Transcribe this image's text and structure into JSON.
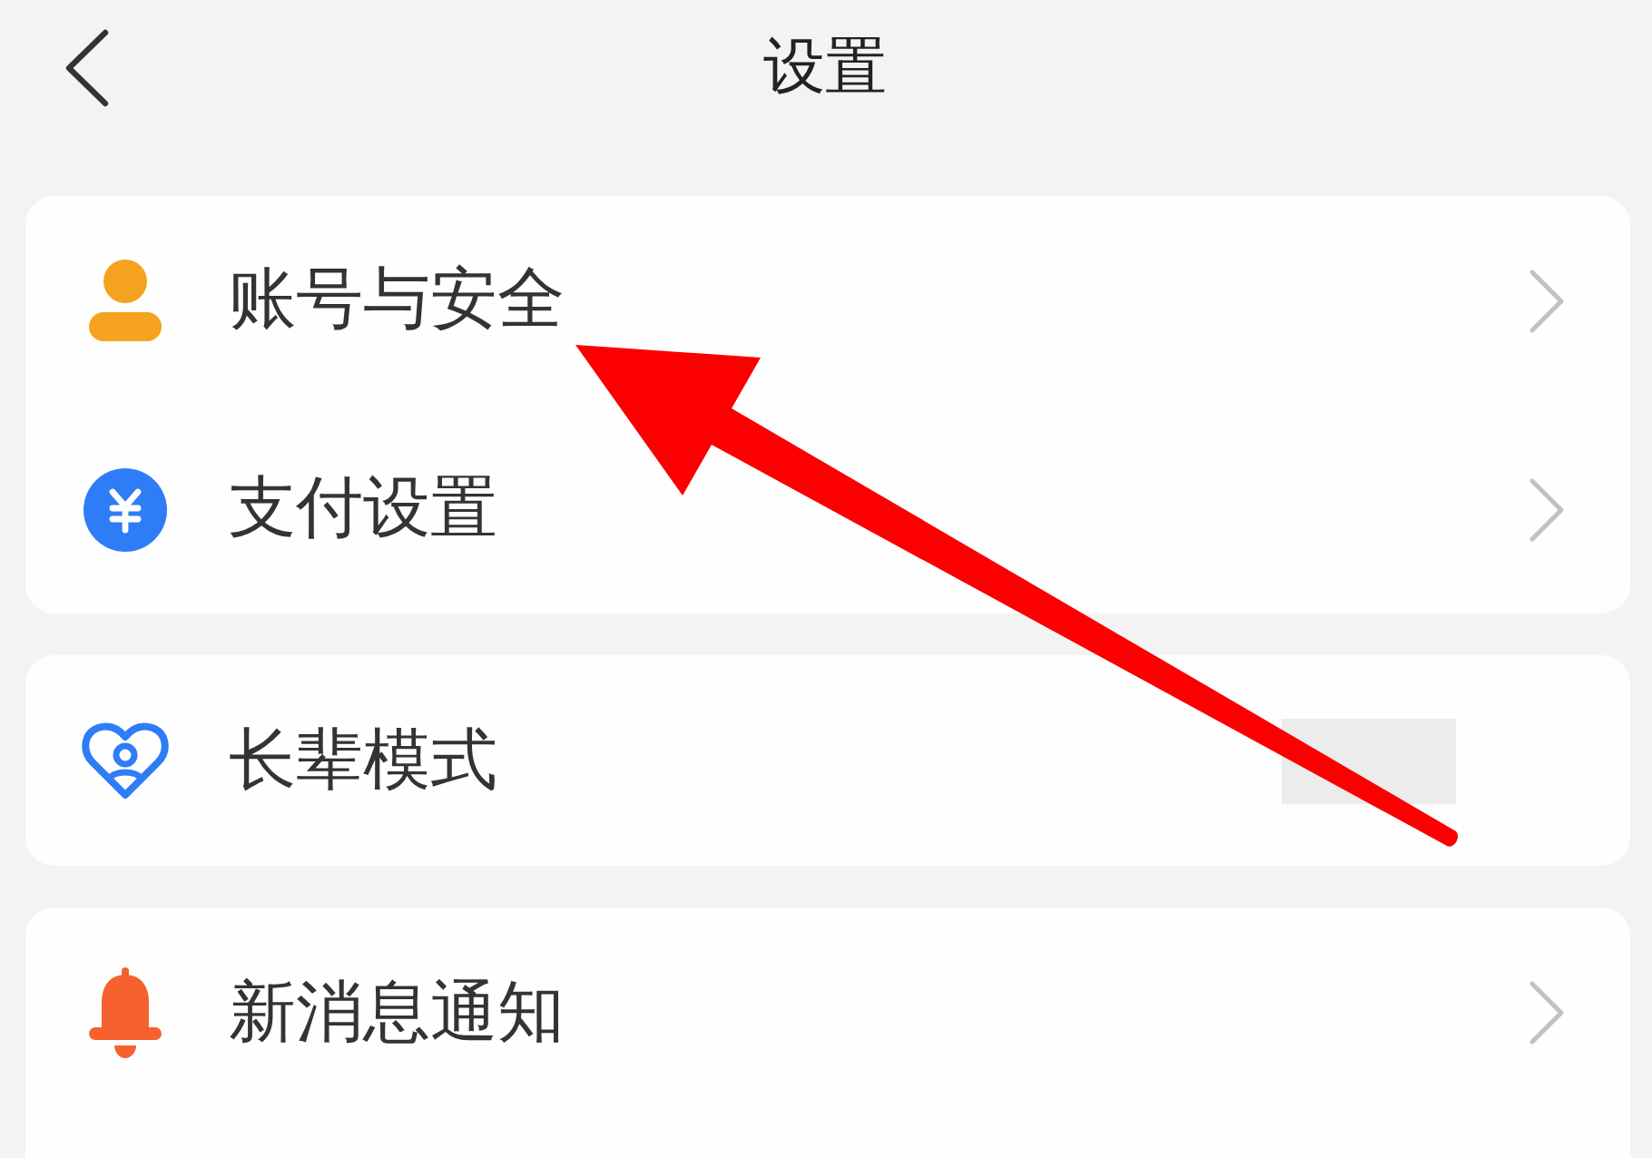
{
  "header": {
    "title": "设置"
  },
  "groups": [
    {
      "items": [
        {
          "label": "账号与安全",
          "kind": "link"
        },
        {
          "label": "支付设置",
          "kind": "link"
        }
      ]
    },
    {
      "items": [
        {
          "label": "长辈模式",
          "kind": "covered"
        }
      ]
    },
    {
      "items": [
        {
          "label": "新消息通知",
          "kind": "link"
        }
      ]
    }
  ],
  "annotations": [
    {
      "kind": "arrow"
    }
  ]
}
